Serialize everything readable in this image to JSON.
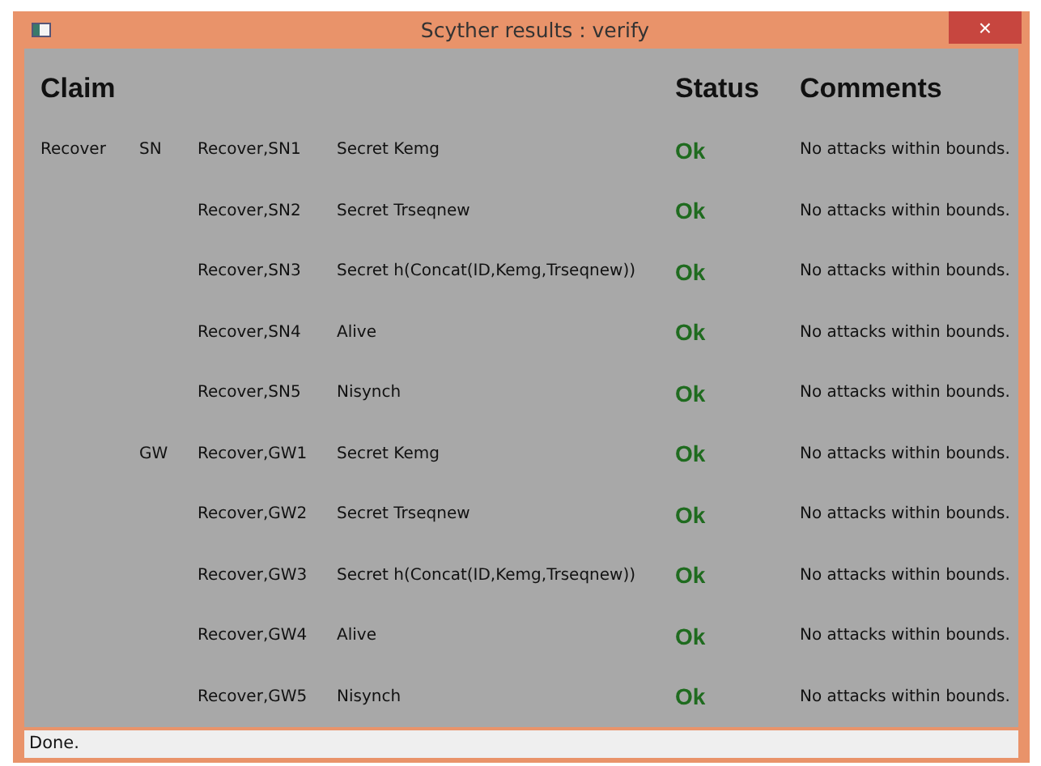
{
  "window": {
    "title": "Scyther results : verify",
    "close": "×"
  },
  "table": {
    "columns": [
      "Claim",
      "Status",
      "Comments"
    ],
    "rows": [
      {
        "protocol": "Recover",
        "role": "SN",
        "id": "Recover,SN1",
        "claim": "Secret Kemg",
        "status": "Ok",
        "comment": "No attacks within bounds."
      },
      {
        "id": "Recover,SN2",
        "claim": "Secret Trseqnew",
        "status": "Ok",
        "comment": "No attacks within bounds."
      },
      {
        "id": "Recover,SN3",
        "claim": "Secret h(Concat(ID,Kemg,Trseqnew))",
        "status": "Ok",
        "comment": "No attacks within bounds."
      },
      {
        "id": "Recover,SN4",
        "claim": "Alive",
        "status": "Ok",
        "comment": "No attacks within bounds."
      },
      {
        "id": "Recover,SN5",
        "claim": "Nisynch",
        "status": "Ok",
        "comment": "No attacks within bounds."
      },
      {
        "role": "GW",
        "id": "Recover,GW1",
        "claim": "Secret Kemg",
        "status": "Ok",
        "comment": "No attacks within bounds."
      },
      {
        "id": "Recover,GW2",
        "claim": "Secret Trseqnew",
        "status": "Ok",
        "comment": "No attacks within bounds."
      },
      {
        "id": "Recover,GW3",
        "claim": "Secret h(Concat(ID,Kemg,Trseqnew))",
        "status": "Ok",
        "comment": "No attacks within bounds."
      },
      {
        "id": "Recover,GW4",
        "claim": "Alive",
        "status": "Ok",
        "comment": "No attacks within bounds."
      },
      {
        "id": "Recover,GW5",
        "claim": "Nisynch",
        "status": "Ok",
        "comment": "No attacks within bounds."
      }
    ]
  },
  "status_bar": "Done."
}
